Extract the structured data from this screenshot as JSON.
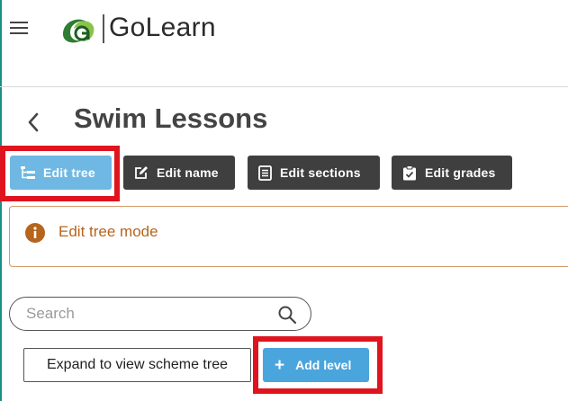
{
  "header": {
    "logo_text": "GoLearn",
    "menu_icon": "hamburger-menu-icon",
    "logo_icon": "golearn-logo-icon"
  },
  "page": {
    "title": "Swim Lessons",
    "back_icon": "chevron-left-icon"
  },
  "toolbar": {
    "edit_tree_label": "Edit tree",
    "edit_name_label": "Edit name",
    "edit_sections_label": "Edit sections",
    "edit_grades_label": "Edit grades"
  },
  "notice": {
    "text": "Edit tree mode",
    "icon": "info-icon"
  },
  "search": {
    "placeholder": "Search",
    "value": ""
  },
  "actions": {
    "expand_label": "Expand to view scheme tree",
    "add_level_label": "Add level"
  },
  "colors": {
    "active_button": "#6fb8e3",
    "dark_button": "#3f3f3f",
    "primary_button": "#4aa5dd",
    "highlight": "#e0141e",
    "notice_text": "#b5651d",
    "notice_border": "#d39a6a"
  }
}
